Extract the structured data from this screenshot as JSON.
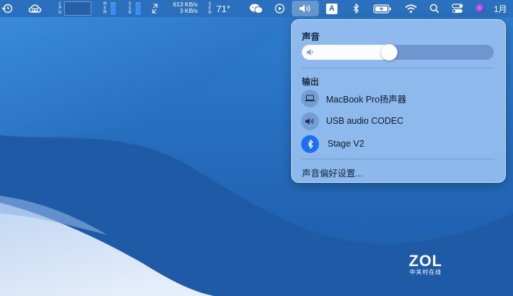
{
  "menubar": {
    "items": [
      {
        "id": "time-machine",
        "icon": "time-machine-icon"
      },
      {
        "id": "creative-cloud",
        "icon": "creative-cloud-icon"
      },
      {
        "id": "cpu",
        "label": "C\nP\nU"
      },
      {
        "id": "mem",
        "label": "M\nE\nM"
      },
      {
        "id": "ssd",
        "label": "S\nS\nD"
      },
      {
        "id": "net",
        "upload": "613 KB/s",
        "download": "3 KB/s"
      },
      {
        "id": "sensors",
        "label": "S\nE\nN",
        "temperature": "71°"
      },
      {
        "id": "wechat",
        "icon": "wechat-icon"
      },
      {
        "id": "play",
        "icon": "play-circle-icon"
      },
      {
        "id": "volume",
        "icon": "speaker-icon",
        "active": true
      },
      {
        "id": "input",
        "icon": "A"
      },
      {
        "id": "bluetooth",
        "icon": "bluetooth-icon"
      },
      {
        "id": "battery",
        "icon": "battery-charging-icon"
      },
      {
        "id": "wifi",
        "icon": "wifi-icon"
      },
      {
        "id": "spotlight",
        "icon": "search-icon"
      },
      {
        "id": "control-center",
        "icon": "control-center-icon"
      },
      {
        "id": "siri",
        "icon": "siri-icon"
      },
      {
        "id": "clock",
        "label": "1月"
      }
    ]
  },
  "sound_panel": {
    "title": "声音",
    "volume_level": 0.45,
    "output_label": "输出",
    "devices": [
      {
        "label": "MacBook Pro扬声器",
        "icon": "laptop-icon",
        "selected": false
      },
      {
        "label": "USB audio CODEC",
        "icon": "speaker-icon",
        "selected": false
      },
      {
        "label": "Stage V2",
        "icon": "bluetooth-icon",
        "selected": true
      }
    ],
    "preferences_link": "声音偏好设置..."
  },
  "watermark": {
    "brand": "ZOL",
    "subtitle": "中关村在线"
  },
  "colors": {
    "wallpaper_dark": "#1a57a6",
    "wallpaper_light": "#3d8ad6",
    "selected_device": "#1e6ff0"
  }
}
